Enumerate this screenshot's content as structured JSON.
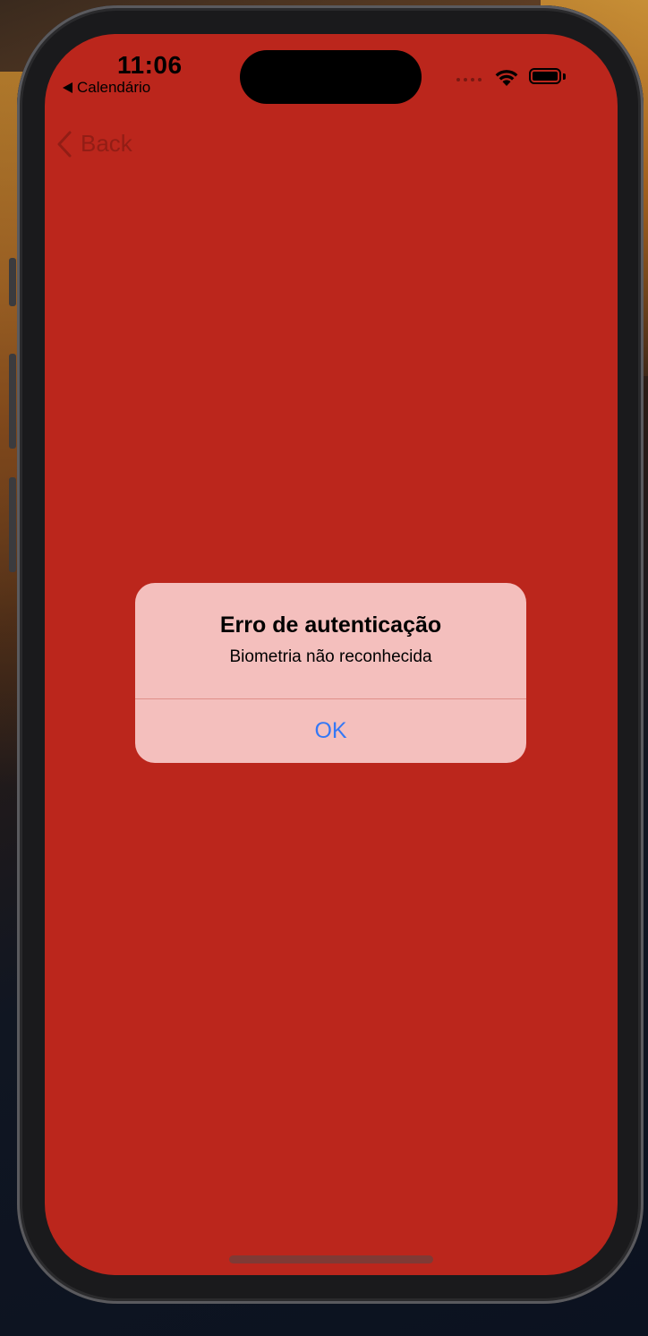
{
  "status_bar": {
    "time": "11:06",
    "back_app_label": "Calendário"
  },
  "nav": {
    "back_label": "Back"
  },
  "alert": {
    "title": "Erro de autenticação",
    "message": "Biometria não reconhecida",
    "ok_label": "OK"
  },
  "colors": {
    "screen_background": "#bb261c",
    "alert_background": "#f4bfbd",
    "alert_button_text": "#3478f6"
  }
}
